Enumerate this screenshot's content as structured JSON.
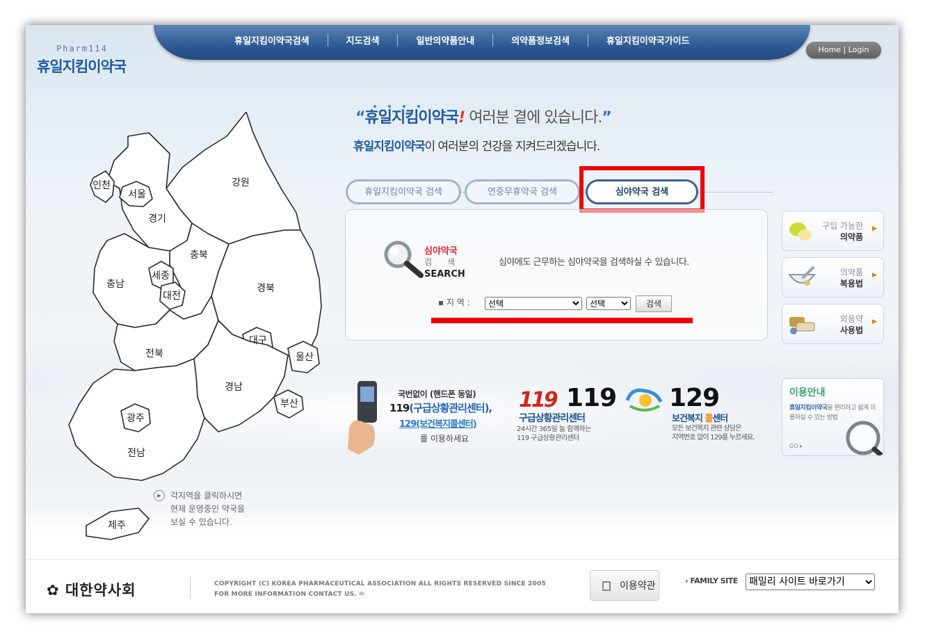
{
  "logo": {
    "en": "Pharm114",
    "ko": "휴일지킴이약국"
  },
  "nav": {
    "items": [
      "휴일지킴이약국검색",
      "지도검색",
      "일반의약품안내",
      "의약품정보검색",
      "휴일지킴이약국가이드"
    ]
  },
  "home_login": "Home | Login",
  "slogan": {
    "quote_open": "“",
    "brand": "휴일지킴이약국",
    "bang": "!",
    "rest": " 여러분 곁에 있습니다.",
    "quote_close": "”",
    "line2_brand": "휴일지킴이약국",
    "line2_rest": "이 여러분의 건강을 지켜드리겠습니다."
  },
  "map": {
    "regions": [
      "인천",
      "서울",
      "강원",
      "경기",
      "충북",
      "충남",
      "세종",
      "대전",
      "경북",
      "대구",
      "전북",
      "울산",
      "경남",
      "광주",
      "부산",
      "전남",
      "제주"
    ],
    "hint": [
      "각지역을 클릭하시면",
      "현재 운영중인 약국을",
      "보실 수 있습니다."
    ]
  },
  "tabs": [
    {
      "label": "휴일지킴이약국 검색",
      "active": false
    },
    {
      "label": "연중무휴약국 검색",
      "active": false
    },
    {
      "label": "심야약국 검색",
      "active": true
    }
  ],
  "search": {
    "label_ko": "심야약국",
    "label_sp": "검색",
    "label_en": "SEARCH",
    "description": "심야에도 근무하는 심야약국을 검색하실 수 있습니다.",
    "region_label": "▪ 지 역 :",
    "select1": "선택",
    "select2": "선택",
    "button": "검색"
  },
  "side": [
    {
      "l1": "구입 가능한",
      "l2": "의약품",
      "icon": "pill-icon"
    },
    {
      "l1": "의약품",
      "l2": "복용법",
      "icon": "mortar-icon"
    },
    {
      "l1": "외용약",
      "l2": "사용법",
      "icon": "ointment-icon"
    }
  ],
  "info": {
    "phone_l1": "국번없이 (핸드폰 동일)",
    "phone_l2a": "119",
    "phone_l2b": "(구급상황관리센터),",
    "phone_l3": "129(보건복지콜센터)",
    "phone_l4": "를 이용하세요",
    "e119_logo": "119",
    "e119_num": "119",
    "e119_title": "구급상황관리센터",
    "e119_desc1": "24시간 365일 늘 함께하는",
    "e119_desc2": "119 구급상황관리센터",
    "w129_num": "129",
    "w129_title_a": "보건복지 ",
    "w129_title_b": "콜",
    "w129_title_c": "센터",
    "w129_desc1": "모든 보건복지 관련 상담은",
    "w129_desc2": "지역번호 없이 129를 누르세요."
  },
  "guide": {
    "title": "이용안내",
    "desc_brand": "휴일지킴이약국",
    "desc_rest": "을 편리하고 쉽게 이용하실 수 있는 방법",
    "go": "GO ▸"
  },
  "footer": {
    "logo": "대한약사회",
    "copy1": "COPYRIGHT (C) KOREA PHARMACEUTICAL ASSOCIATION ALL RIGHTS RESERVED SINCE 2005",
    "copy2": "FOR MORE INFORMATION CONTACT US. ✉",
    "terms": "이용약관",
    "family_label": "› FAMILY SITE",
    "family_select": "패밀리 사이트 바로가기"
  },
  "colors": {
    "nav": "#2f5d96",
    "brand": "#1f5b9c",
    "highlight_red": "#ee0000",
    "map_stroke": "#2a2a2a"
  }
}
